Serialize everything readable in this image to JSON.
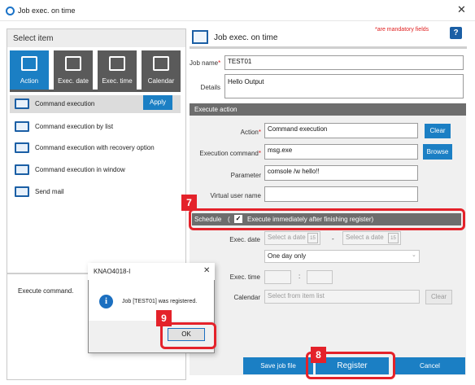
{
  "window": {
    "title": "Job exec. on time",
    "close": "✕"
  },
  "left": {
    "header": "Select item",
    "tabs": [
      {
        "label": "Action",
        "icon": "command-icon"
      },
      {
        "label": "Exec. date",
        "icon": "calendar-31-icon"
      },
      {
        "label": "Exec. time",
        "icon": "checkbox-icon"
      },
      {
        "label": "Calendar",
        "icon": "calendar-grid-icon"
      }
    ],
    "items": [
      {
        "label": "Command execution"
      },
      {
        "label": "Command execution by list"
      },
      {
        "label": "Command execution with recovery option"
      },
      {
        "label": "Command execution in window"
      },
      {
        "label": "Send mail"
      }
    ],
    "apply": "Apply",
    "description": "Execute command."
  },
  "right": {
    "title": "Job exec. on time",
    "mandatory_note": "*are mandatory fields",
    "help": "?",
    "job_name_label": "Job name",
    "job_name": "TEST01",
    "details_label": "Details",
    "details": "Hello Output",
    "execute_action_header": "Execute action",
    "action_label": "Action",
    "action_value": "Command execution",
    "clear": "Clear",
    "exec_cmd_label": "Execution command",
    "exec_cmd_value": "msg.exe",
    "browse": "Browse",
    "param_label": "Parameter",
    "param_value": "comsole /w hello!!",
    "virtual_user_label": "Virtual user name",
    "virtual_user_value": "",
    "schedule_label": "Schedule",
    "schedule_paren": "(",
    "schedule_check": "✓",
    "schedule_option": "Execute immediately after finishing register)",
    "exec_date_label": "Exec. date",
    "date_placeholder_1": "Select a date",
    "date_placeholder_2": "Select a date",
    "date_sep": "-",
    "date_cal": "15",
    "day_select": "One day only",
    "exec_time_label": "Exec. time",
    "time_sep": ":",
    "calendar_label": "Calendar",
    "calendar_placeholder": "Select from item list",
    "calendar_clear": "Clear",
    "save_job": "Save job file",
    "register": "Register",
    "cancel": "Cancel"
  },
  "dialog": {
    "title": "KNAO4018-I",
    "close": "✕",
    "icon": "i",
    "message": "Job [TEST01] was registered.",
    "ok": "OK"
  },
  "steps": {
    "s7": "7",
    "s8": "8",
    "s9": "9"
  },
  "colors": {
    "accent": "#1b7fc4",
    "highlight": "#e4222a",
    "dark_bar": "#6d6d6d"
  }
}
